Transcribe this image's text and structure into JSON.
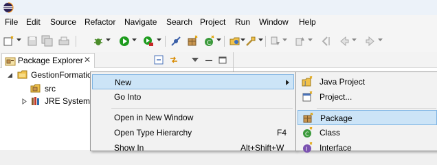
{
  "menubar": [
    "File",
    "Edit",
    "Source",
    "Refactor",
    "Navigate",
    "Search",
    "Project",
    "Run",
    "Window",
    "Help"
  ],
  "package_explorer": {
    "title": "Package Explorer",
    "close_glyph": "✕",
    "tree": [
      {
        "label": "GestionFormatio",
        "icon": "project-folder-icon"
      },
      {
        "label": "src",
        "icon": "source-folder-icon"
      },
      {
        "label": "JRE System L",
        "icon": "library-icon"
      }
    ]
  },
  "context_menu": {
    "items": [
      {
        "label": "New",
        "submenu": true,
        "selected": true
      },
      {
        "label": "Go Into"
      },
      {
        "label": "Open in New Window"
      },
      {
        "label": "Open Type Hierarchy",
        "accel": "F4"
      },
      {
        "label": "Show In",
        "accel": "Alt+Shift+W"
      }
    ]
  },
  "new_submenu": {
    "items": [
      {
        "label": "Java Project",
        "icon": "java-project-icon"
      },
      {
        "label": "Project...",
        "icon": "project-wizard-icon"
      },
      {
        "label": "Package",
        "icon": "package-icon",
        "selected": true
      },
      {
        "label": "Class",
        "icon": "class-icon"
      },
      {
        "label": "Interface",
        "icon": "interface-icon"
      }
    ]
  },
  "colors": {
    "selection": "#cce4f7",
    "selection_border": "#7fb4e3",
    "menu_bg": "#f2f2f2"
  }
}
